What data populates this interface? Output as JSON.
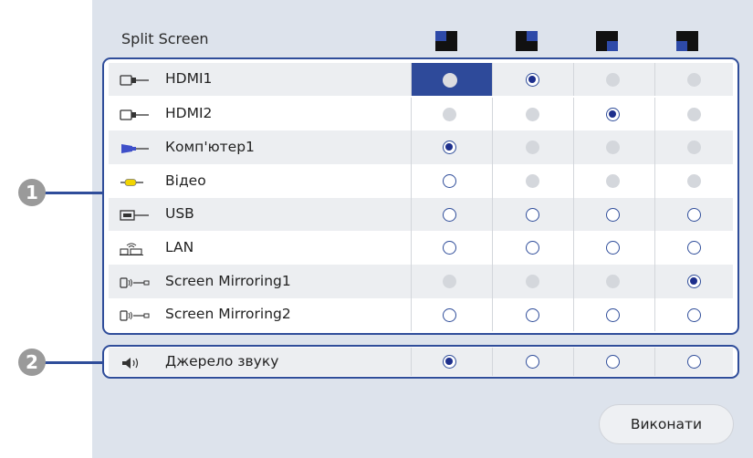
{
  "title": "Split Screen",
  "layout_icons": [
    "layout-left-top-icon",
    "layout-left-l-icon",
    "layout-right-l-icon",
    "layout-right-top-icon"
  ],
  "sources": [
    {
      "label": "HDMI1",
      "icon": "hdmi-icon",
      "radios": [
        "highlight",
        "selected",
        "disabled",
        "disabled"
      ]
    },
    {
      "label": "HDMI2",
      "icon": "hdmi-icon",
      "radios": [
        "disabled",
        "disabled",
        "selected",
        "disabled"
      ]
    },
    {
      "label": "Комп'ютер1",
      "icon": "vga-computer-icon",
      "radios": [
        "selected",
        "disabled",
        "disabled",
        "disabled"
      ]
    },
    {
      "label": "Відео",
      "icon": "video-rca-icon",
      "radios": [
        "empty",
        "disabled",
        "disabled",
        "disabled"
      ]
    },
    {
      "label": "USB",
      "icon": "usb-icon",
      "radios": [
        "empty",
        "empty",
        "empty",
        "empty"
      ]
    },
    {
      "label": "LAN",
      "icon": "lan-icon",
      "radios": [
        "empty",
        "empty",
        "empty",
        "empty"
      ]
    },
    {
      "label": "Screen Mirroring1",
      "icon": "screen-mirroring-icon",
      "radios": [
        "disabled",
        "disabled",
        "disabled",
        "selected"
      ]
    },
    {
      "label": "Screen Mirroring2",
      "icon": "screen-mirroring-icon",
      "radios": [
        "empty",
        "empty",
        "empty",
        "empty"
      ]
    }
  ],
  "audio": {
    "label": "Джерело звуку",
    "icon": "speaker-icon",
    "radios": [
      "selected",
      "empty",
      "empty",
      "empty"
    ]
  },
  "callouts": [
    "1",
    "2"
  ],
  "execute_label": "Виконати",
  "colors": {
    "accent": "#2f4d9a",
    "panel": "#dde3ec",
    "selected_dot": "#1d2f8c"
  }
}
